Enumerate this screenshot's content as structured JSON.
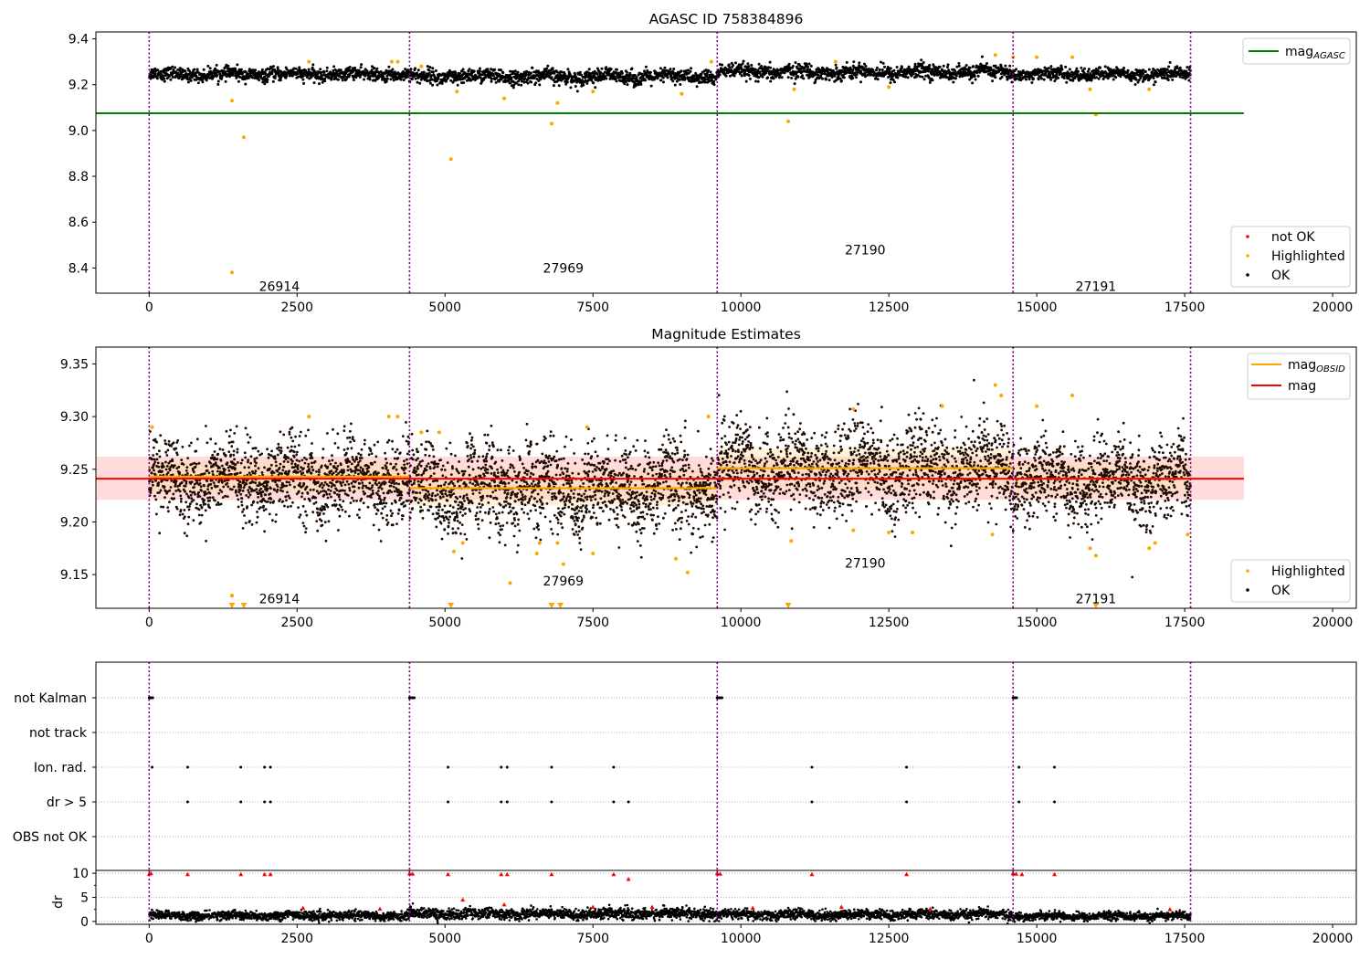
{
  "chart_data": [
    {
      "type": "scatter",
      "title": "AGASC ID 758384896",
      "xlabel": "",
      "ylabel": "",
      "xlim": [
        -900,
        20400
      ],
      "ylim": [
        8.29,
        9.43
      ],
      "xticks": [
        0,
        2500,
        5000,
        7500,
        10000,
        12500,
        15000,
        17500,
        20000
      ],
      "yticks": [
        8.4,
        8.6,
        8.8,
        9.0,
        9.2,
        9.4
      ],
      "grid": false,
      "vlines": [
        0,
        4400,
        9600,
        14600,
        17600
      ],
      "obsids": [
        {
          "label": "26914",
          "x": 2200,
          "y": 8.32
        },
        {
          "label": "27969",
          "x": 7000,
          "y": 8.4
        },
        {
          "label": "27190",
          "x": 12100,
          "y": 8.48
        },
        {
          "label": "27191",
          "x": 16000,
          "y": 8.32
        }
      ],
      "hline": {
        "name": "mag",
        "subscript": "AGASC",
        "y": 9.075,
        "x0": -900,
        "x1": 18500,
        "color": "#008000"
      },
      "legend_lines": {
        "placement": "top-right",
        "entries": [
          {
            "name": "mag",
            "subscript": "AGASC",
            "color": "#008000"
          }
        ]
      },
      "legend_points": {
        "placement": "bottom-right",
        "entries": [
          {
            "name": "not OK",
            "color": "#ff0000"
          },
          {
            "name": "Highlighted",
            "color": "#ffa500"
          },
          {
            "name": "OK",
            "color": "#000000"
          }
        ]
      },
      "series": [
        {
          "name": "OK",
          "color": "#000000",
          "kind": "band",
          "segments": [
            {
              "x0": 0,
              "x1": 4400,
              "center": 9.245,
              "halfwidth": 0.03
            },
            {
              "x0": 4400,
              "x1": 9600,
              "center": 9.235,
              "halfwidth": 0.035
            },
            {
              "x0": 9600,
              "x1": 14600,
              "center": 9.255,
              "halfwidth": 0.035
            },
            {
              "x0": 14600,
              "x1": 17600,
              "center": 9.245,
              "halfwidth": 0.03
            }
          ]
        },
        {
          "name": "Highlighted",
          "color": "#ffa500",
          "kind": "points",
          "points": [
            [
              1400,
              9.13
            ],
            [
              1400,
              8.38
            ],
            [
              1600,
              8.97
            ],
            [
              5100,
              8.875
            ],
            [
              6800,
              9.03
            ],
            [
              6900,
              9.12
            ],
            [
              9000,
              9.16
            ],
            [
              10800,
              9.04
            ],
            [
              10900,
              9.18
            ],
            [
              6000,
              9.14
            ],
            [
              2700,
              9.3
            ],
            [
              4100,
              9.3
            ],
            [
              4200,
              9.3
            ],
            [
              4600,
              9.28
            ],
            [
              9500,
              9.3
            ],
            [
              11600,
              9.3
            ],
            [
              14300,
              9.33
            ],
            [
              14600,
              9.32
            ],
            [
              15000,
              9.32
            ],
            [
              15600,
              9.32
            ],
            [
              15900,
              9.18
            ],
            [
              16000,
              9.07
            ],
            [
              16900,
              9.18
            ],
            [
              5200,
              9.17
            ],
            [
              7500,
              9.17
            ],
            [
              12500,
              9.19
            ]
          ]
        }
      ]
    },
    {
      "type": "scatter",
      "title": "Magnitude Estimates",
      "xlabel": "",
      "ylabel": "",
      "xlim": [
        -900,
        20400
      ],
      "ylim": [
        9.118,
        9.366
      ],
      "xticks": [
        0,
        2500,
        5000,
        7500,
        10000,
        12500,
        15000,
        17500,
        20000
      ],
      "yticks": [
        9.15,
        9.2,
        9.25,
        9.3,
        9.35
      ],
      "grid": false,
      "vlines": [
        0,
        4400,
        9600,
        14600,
        17600
      ],
      "obsids": [
        {
          "label": "26914",
          "x": 2200,
          "y": 9.127
        },
        {
          "label": "27969",
          "x": 7000,
          "y": 9.144
        },
        {
          "label": "27190",
          "x": 12100,
          "y": 9.161
        },
        {
          "label": "27191",
          "x": 16000,
          "y": 9.127
        }
      ],
      "mag_line": {
        "name": "mag",
        "y": 9.241,
        "band": [
          9.221,
          9.262
        ],
        "x0": -900,
        "x1": 18500,
        "color": "#ff0000",
        "band_color": "#ffcccc"
      },
      "obsid_lines": {
        "name": "mag",
        "subscript": "OBSID",
        "color": "#ffa500",
        "segments": [
          {
            "x0": 0,
            "x1": 4400,
            "y": 9.243,
            "band": [
              9.228,
              9.258
            ]
          },
          {
            "x0": 4400,
            "x1": 9600,
            "y": 9.232,
            "band": [
              9.215,
              9.249
            ]
          },
          {
            "x0": 9600,
            "x1": 14600,
            "y": 9.251,
            "band": [
              9.232,
              9.27
            ]
          },
          {
            "x0": 14600,
            "x1": 17600,
            "y": 9.241,
            "band": [
              9.226,
              9.256
            ]
          }
        ]
      },
      "legend_lines": {
        "placement": "top-right",
        "entries": [
          {
            "name": "mag",
            "subscript": "OBSID",
            "color": "#ffa500"
          },
          {
            "name": "mag",
            "subscript": "",
            "color": "#ff0000"
          }
        ]
      },
      "legend_points": {
        "placement": "bottom-right",
        "entries": [
          {
            "name": "Highlighted",
            "color": "#ffa500"
          },
          {
            "name": "OK",
            "color": "#000000"
          }
        ]
      },
      "series": [
        {
          "name": "OK",
          "color": "#000000",
          "kind": "band",
          "segments": [
            {
              "x0": 0,
              "x1": 4400,
              "center": 9.24,
              "halfwidth": 0.04
            },
            {
              "x0": 4400,
              "x1": 9600,
              "center": 9.232,
              "halfwidth": 0.045
            },
            {
              "x0": 9600,
              "x1": 14600,
              "center": 9.25,
              "halfwidth": 0.045
            },
            {
              "x0": 14600,
              "x1": 17600,
              "center": 9.24,
              "halfwidth": 0.04
            }
          ]
        },
        {
          "name": "Highlighted",
          "color": "#ffa500",
          "kind": "points",
          "points": [
            [
              50,
              9.29
            ],
            [
              2700,
              9.3
            ],
            [
              4050,
              9.3
            ],
            [
              4200,
              9.3
            ],
            [
              4600,
              9.285
            ],
            [
              4900,
              9.285
            ],
            [
              7400,
              9.29
            ],
            [
              9450,
              9.3
            ],
            [
              11900,
              9.307
            ],
            [
              13400,
              9.31
            ],
            [
              14300,
              9.33
            ],
            [
              14400,
              9.32
            ],
            [
              15000,
              9.31
            ],
            [
              15600,
              9.32
            ],
            [
              5150,
              9.172
            ],
            [
              5300,
              9.18
            ],
            [
              6100,
              9.142
            ],
            [
              6550,
              9.17
            ],
            [
              6600,
              9.18
            ],
            [
              6900,
              9.18
            ],
            [
              7000,
              9.16
            ],
            [
              7500,
              9.17
            ],
            [
              8900,
              9.165
            ],
            [
              9100,
              9.152
            ],
            [
              10850,
              9.182
            ],
            [
              11900,
              9.192
            ],
            [
              12500,
              9.19
            ],
            [
              12900,
              9.19
            ],
            [
              14250,
              9.188
            ],
            [
              15900,
              9.175
            ],
            [
              16000,
              9.168
            ],
            [
              16900,
              9.175
            ],
            [
              17000,
              9.18
            ],
            [
              17550,
              9.188
            ],
            [
              1400,
              9.13
            ],
            [
              1400,
              9.13
            ]
          ]
        },
        {
          "name": "Highlighted (off scale)",
          "color": "#ffa500",
          "kind": "triangles",
          "points": [
            [
              1400,
              9.122
            ],
            [
              1600,
              9.122
            ],
            [
              5100,
              9.122
            ],
            [
              6800,
              9.122
            ],
            [
              6950,
              9.122
            ],
            [
              10800,
              9.122
            ],
            [
              16000,
              9.122
            ]
          ]
        }
      ]
    },
    {
      "type": "scatter",
      "title": "",
      "xlabel": "",
      "ylabel": "",
      "xlim": [
        -900,
        20400
      ],
      "categories": [
        "not Kalman",
        "not track",
        "Ion. rad.",
        "dr > 5",
        "OBS not OK"
      ],
      "grid": true,
      "vlines": [
        0,
        4400,
        9600,
        14600,
        17600
      ],
      "flags": [
        {
          "category": "not Kalman",
          "x": [
            0,
            20,
            40,
            60,
            4400,
            4420,
            4440,
            4460,
            4480,
            9600,
            9620,
            9640,
            9660,
            9680,
            14600,
            14620,
            14640,
            14660
          ]
        },
        {
          "category": "not track",
          "x": []
        },
        {
          "category": "Ion. rad.",
          "x": [
            50,
            650,
            1550,
            1950,
            2050,
            5050,
            5950,
            6050,
            6800,
            7850,
            11200,
            12800,
            14700,
            15300
          ]
        },
        {
          "category": "dr > 5",
          "x": [
            650,
            1550,
            1950,
            2050,
            5050,
            5950,
            6050,
            6800,
            7850,
            8100,
            11200,
            12800,
            14700,
            15300
          ]
        },
        {
          "category": "OBS not OK",
          "x": []
        }
      ]
    },
    {
      "type": "scatter",
      "title": "",
      "xlabel": "",
      "ylabel": "dr",
      "xlim": [
        -900,
        20400
      ],
      "ylim": [
        -0.6,
        10.6
      ],
      "xticks": [
        0,
        2500,
        5000,
        7500,
        10000,
        12500,
        15000,
        17500,
        20000
      ],
      "yticks": [
        0,
        5,
        10
      ],
      "grid": true,
      "vlines": [
        0,
        4400,
        9600,
        14600,
        17600
      ],
      "series": [
        {
          "name": "OK",
          "color": "#000000",
          "kind": "band",
          "segments": [
            {
              "x0": 0,
              "x1": 4400,
              "center": 1.2,
              "halfwidth": 1.0
            },
            {
              "x0": 4400,
              "x1": 9600,
              "center": 1.6,
              "halfwidth": 1.2
            },
            {
              "x0": 9600,
              "x1": 14600,
              "center": 1.4,
              "halfwidth": 1.1
            },
            {
              "x0": 14600,
              "x1": 17600,
              "center": 1.1,
              "halfwidth": 0.9
            }
          ]
        },
        {
          "name": "not OK",
          "color": "#ff0000",
          "kind": "points",
          "points": [
            [
              0,
              9.9
            ],
            [
              30,
              10.0
            ],
            [
              650,
              9.8
            ],
            [
              1550,
              9.8
            ],
            [
              1950,
              9.8
            ],
            [
              2050,
              9.8
            ],
            [
              4400,
              10.0
            ],
            [
              4450,
              9.9
            ],
            [
              5050,
              9.8
            ],
            [
              5950,
              9.8
            ],
            [
              6050,
              9.8
            ],
            [
              6800,
              9.8
            ],
            [
              7850,
              9.8
            ],
            [
              8100,
              8.8
            ],
            [
              9600,
              10.0
            ],
            [
              9650,
              9.9
            ],
            [
              11200,
              9.8
            ],
            [
              12800,
              9.8
            ],
            [
              14600,
              10.0
            ],
            [
              14650,
              9.9
            ],
            [
              14750,
              9.8
            ],
            [
              15300,
              9.8
            ],
            [
              5300,
              4.5
            ],
            [
              6000,
              3.5
            ],
            [
              7500,
              3.0
            ],
            [
              8500,
              3.0
            ],
            [
              10200,
              2.8
            ],
            [
              11700,
              3.0
            ],
            [
              13200,
              2.6
            ],
            [
              17250,
              2.5
            ],
            [
              2600,
              2.8
            ],
            [
              3900,
              2.6
            ]
          ]
        }
      ]
    }
  ]
}
